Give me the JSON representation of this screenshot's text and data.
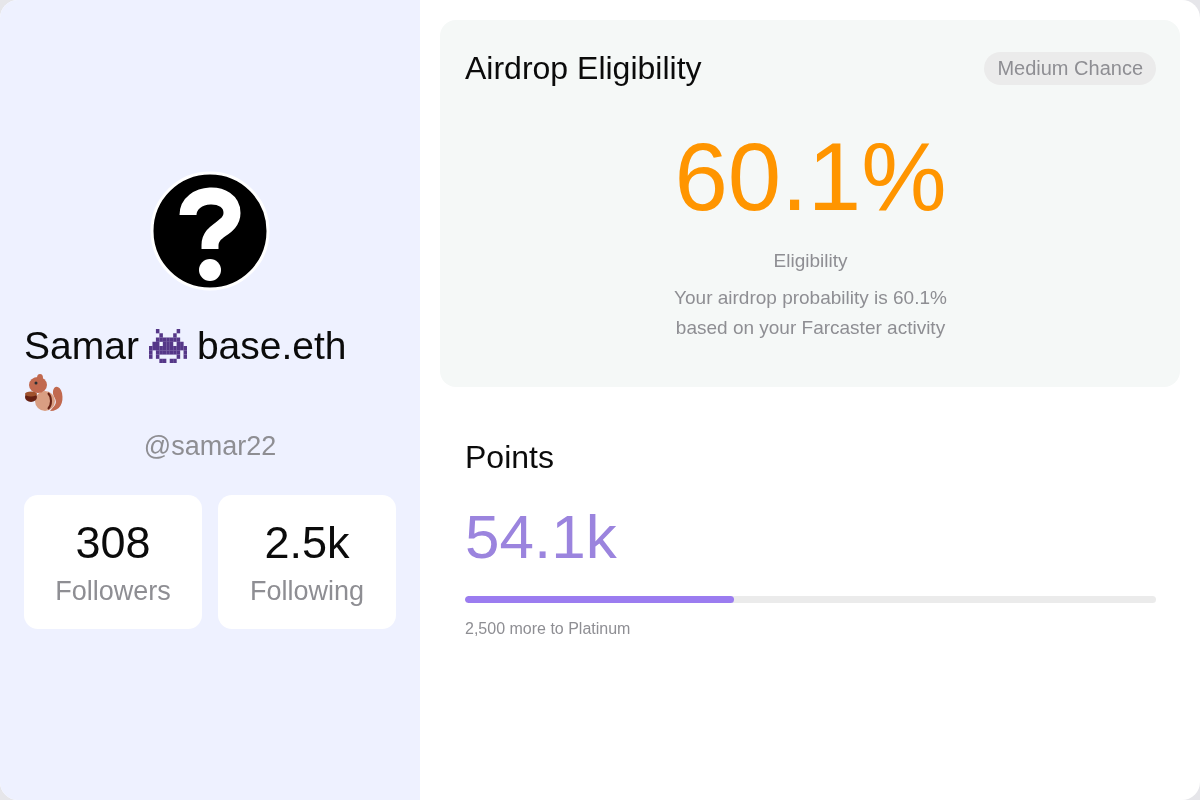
{
  "profile": {
    "name_words": [
      "Samar",
      "base.eth"
    ],
    "handle": "@samar22",
    "stats": [
      {
        "value": "308",
        "label": "Followers"
      },
      {
        "value": "2.5k",
        "label": "Following"
      }
    ]
  },
  "eligibility": {
    "title": "Airdrop Eligibility",
    "badge": "Medium Chance",
    "percentage": "60.1%",
    "label": "Eligibility",
    "description": "Your airdrop probability is 60.1% based on your Farcaster activity"
  },
  "points": {
    "title": "Points",
    "value": "54.1k",
    "progress": {
      "level": 0.39
    },
    "caption": "2,500 more to Platinum"
  }
}
